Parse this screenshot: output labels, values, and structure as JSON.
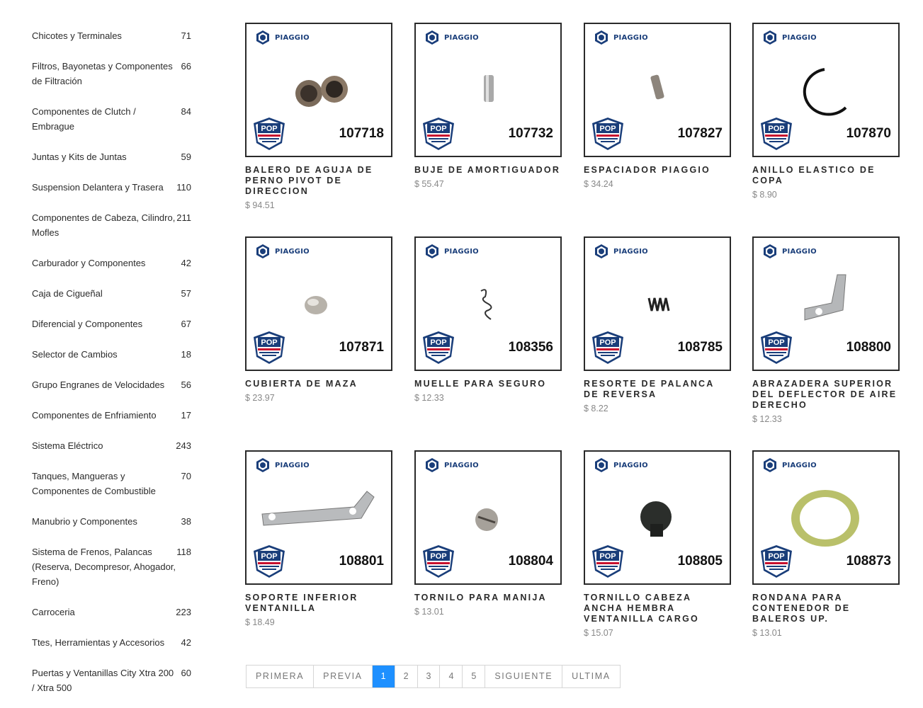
{
  "categories": [
    {
      "name": "Chicotes y Terminales",
      "count": "71"
    },
    {
      "name": "Filtros, Bayonetas y Componentes de Filtración",
      "count": "66"
    },
    {
      "name": "Componentes de Clutch / Embrague",
      "count": "84"
    },
    {
      "name": "Juntas y Kits de Juntas",
      "count": "59"
    },
    {
      "name": "Suspension Delantera y Trasera",
      "count": "110"
    },
    {
      "name": "Componentes de Cabeza, Cilindro, Mofles",
      "count": "211"
    },
    {
      "name": "Carburador y Componentes",
      "count": "42"
    },
    {
      "name": "Caja de Cigueñal",
      "count": "57"
    },
    {
      "name": "Diferencial y Componentes",
      "count": "67"
    },
    {
      "name": "Selector de Cambios",
      "count": "18"
    },
    {
      "name": "Grupo Engranes de Velocidades",
      "count": "56"
    },
    {
      "name": "Componentes de Enfriamiento",
      "count": "17"
    },
    {
      "name": "Sistema Eléctrico",
      "count": "243"
    },
    {
      "name": "Tanques, Mangueras y Componentes de Combustible",
      "count": "70"
    },
    {
      "name": "Manubrio y Componentes",
      "count": "38"
    },
    {
      "name": "Sistema de Frenos, Palancas (Reserva, Decompresor, Ahogador, Freno)",
      "count": "118"
    },
    {
      "name": "Carroceria",
      "count": "223"
    },
    {
      "name": "Ttes, Herramientas y Accesorios",
      "count": "42"
    },
    {
      "name": "Puertas y Ventanillas City Xtra 200 / Xtra 500",
      "count": "60"
    }
  ],
  "brand": {
    "name": "PIAGGIO",
    "badge": "POP",
    "badge_sub": "SEGURIDAD · CONFIABILIDAD · DURACIÓN"
  },
  "products": [
    {
      "code": "107718",
      "title": "BALERO DE AGUJA DE PERNO PIVOT DE DIRECCION",
      "price": "$ 94.51",
      "icon": "bearing-pair-icon"
    },
    {
      "code": "107732",
      "title": "BUJE DE AMORTIGUADOR",
      "price": "$ 55.47",
      "icon": "bushing-icon"
    },
    {
      "code": "107827",
      "title": "ESPACIADOR PIAGGIO",
      "price": "$ 34.24",
      "icon": "spacer-icon"
    },
    {
      "code": "107870",
      "title": "ANILLO ELASTICO DE COPA",
      "price": "$ 8.90",
      "icon": "snap-ring-icon"
    },
    {
      "code": "107871",
      "title": "CUBIERTA DE MAZA",
      "price": "$ 23.97",
      "icon": "hub-cap-icon"
    },
    {
      "code": "108356",
      "title": "MUELLE PARA SEGURO",
      "price": "$ 12.33",
      "icon": "small-spring-icon"
    },
    {
      "code": "108785",
      "title": "RESORTE DE PALANCA DE REVERSA",
      "price": "$ 8.22",
      "icon": "coil-spring-icon"
    },
    {
      "code": "108800",
      "title": "ABRAZADERA SUPERIOR DEL DEFLECTOR DE AIRE DERECHO",
      "price": "$ 12.33",
      "icon": "bracket-icon"
    },
    {
      "code": "108801",
      "title": "SOPORTE INFERIOR VENTANILLA",
      "price": "$ 18.49",
      "icon": "flat-bracket-icon"
    },
    {
      "code": "108804",
      "title": "TORNILO PARA MANIJA",
      "price": "$ 13.01",
      "icon": "screw-head-icon"
    },
    {
      "code": "108805",
      "title": "TORNILLO CABEZA ANCHA HEMBRA VENTANILLA CARGO",
      "price": "$ 15.07",
      "icon": "wide-screw-icon"
    },
    {
      "code": "108873",
      "title": "RONDANA PARA CONTENEDOR DE BALEROS UP.",
      "price": "$ 13.01",
      "icon": "washer-icon"
    }
  ],
  "pagination": {
    "first": "PRIMERA",
    "prev": "PREVIA",
    "pages": [
      "1",
      "2",
      "3",
      "4",
      "5"
    ],
    "current": "1",
    "next": "SIGUIENTE",
    "last": "ULTIMA"
  },
  "colors": {
    "accent": "#1e90ff",
    "brand_blue": "#1a3e7a",
    "badge_red": "#c8102e"
  }
}
